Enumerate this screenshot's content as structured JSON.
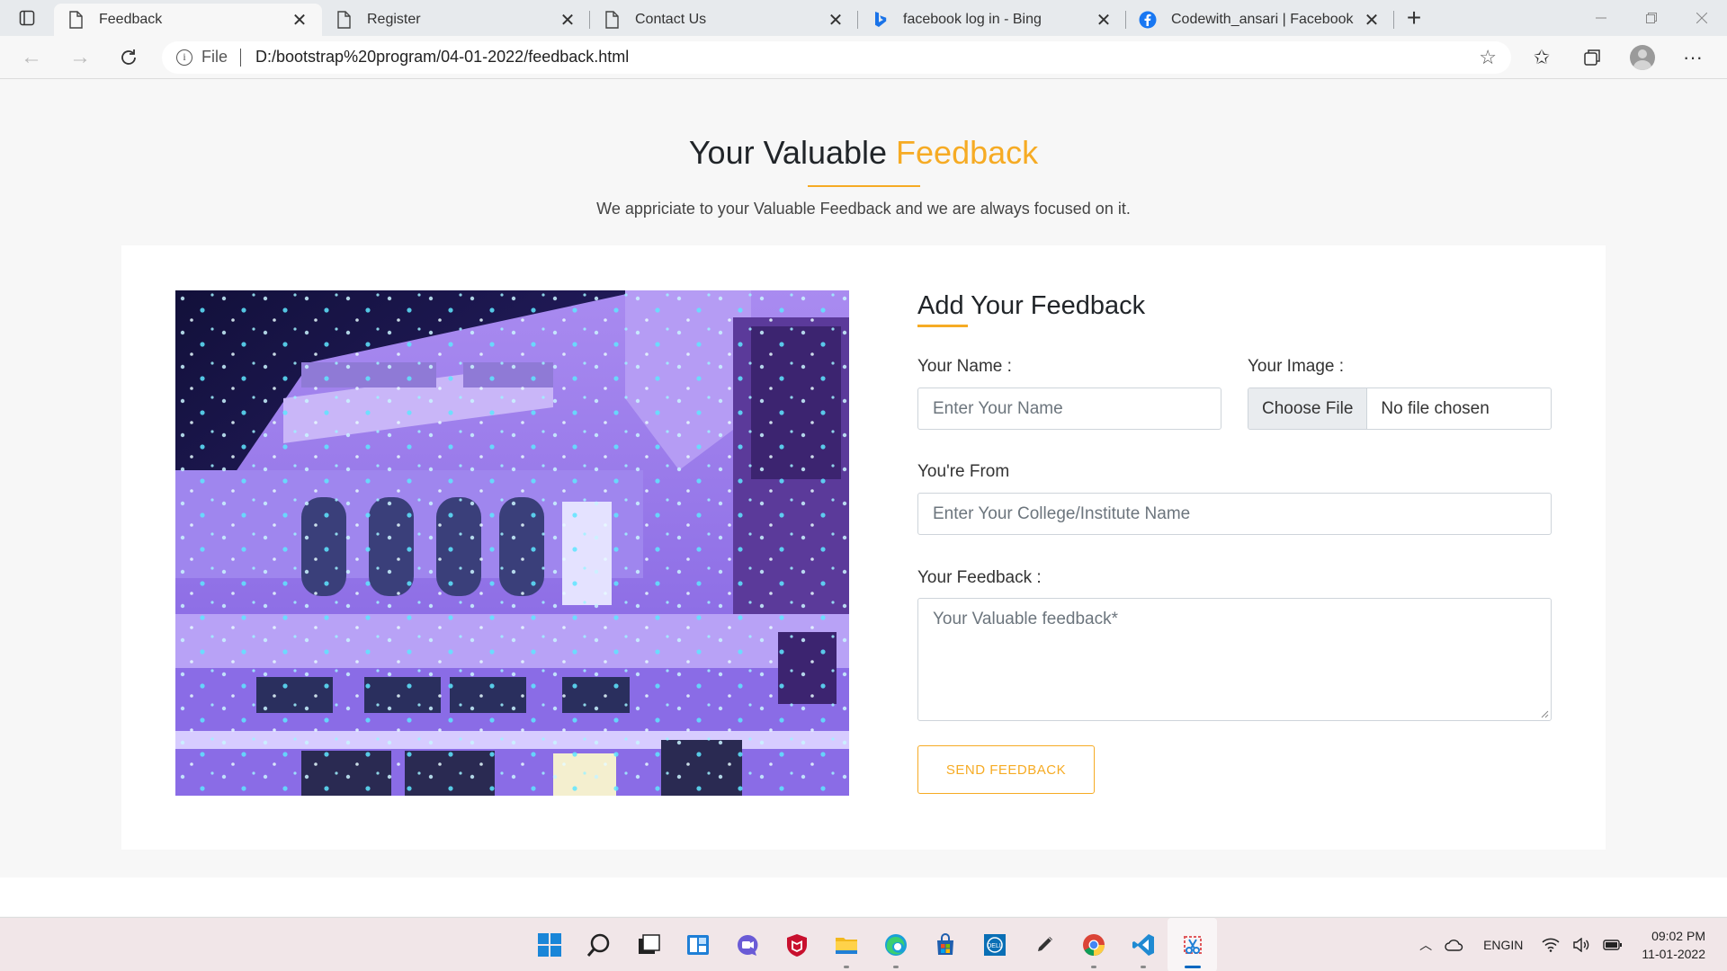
{
  "browser": {
    "tabs": [
      {
        "title": "Feedback",
        "icon": "page-icon",
        "active": true
      },
      {
        "title": "Register",
        "icon": "page-icon",
        "active": false
      },
      {
        "title": "Contact Us",
        "icon": "page-icon",
        "active": false
      },
      {
        "title": "facebook log in - Bing",
        "icon": "bing-icon",
        "active": false
      },
      {
        "title": "Codewith_ansari | Facebook",
        "icon": "facebook-icon",
        "active": false
      }
    ],
    "address": {
      "scheme_label": "File",
      "url": "D:/bootstrap%20program/04-01-2022/feedback.html"
    }
  },
  "page": {
    "heading_main": "Your Valuable",
    "heading_accent": "Feedback",
    "subtitle": "We appriciate to your Valuable Feedback and we are always focused on it.",
    "accent_color": "#f6ab24",
    "form": {
      "title": "Add Your Feedback",
      "name_label": "Your Name :",
      "name_placeholder": "Enter Your Name",
      "image_label": "Your Image :",
      "file_button": "Choose File",
      "file_status": "No file chosen",
      "from_label": "You're From",
      "from_placeholder": "Enter Your College/Institute Name",
      "feedback_label": "Your Feedback :",
      "feedback_placeholder": "Your Valuable feedback*",
      "submit_label": "SEND FEEDBACK"
    }
  },
  "taskbar": {
    "apps": [
      "windows-start-icon",
      "search-icon",
      "task-view-icon",
      "widgets-icon",
      "chat-icon",
      "mcafee-icon",
      "file-explorer-icon",
      "edge-icon",
      "store-icon",
      "dell-icon",
      "pen-icon",
      "chrome-icon",
      "vscode-icon",
      "snipping-tool-icon"
    ],
    "language_top": "ENG",
    "language_bottom": "IN",
    "time": "09:02 PM",
    "date": "11-01-2022"
  }
}
